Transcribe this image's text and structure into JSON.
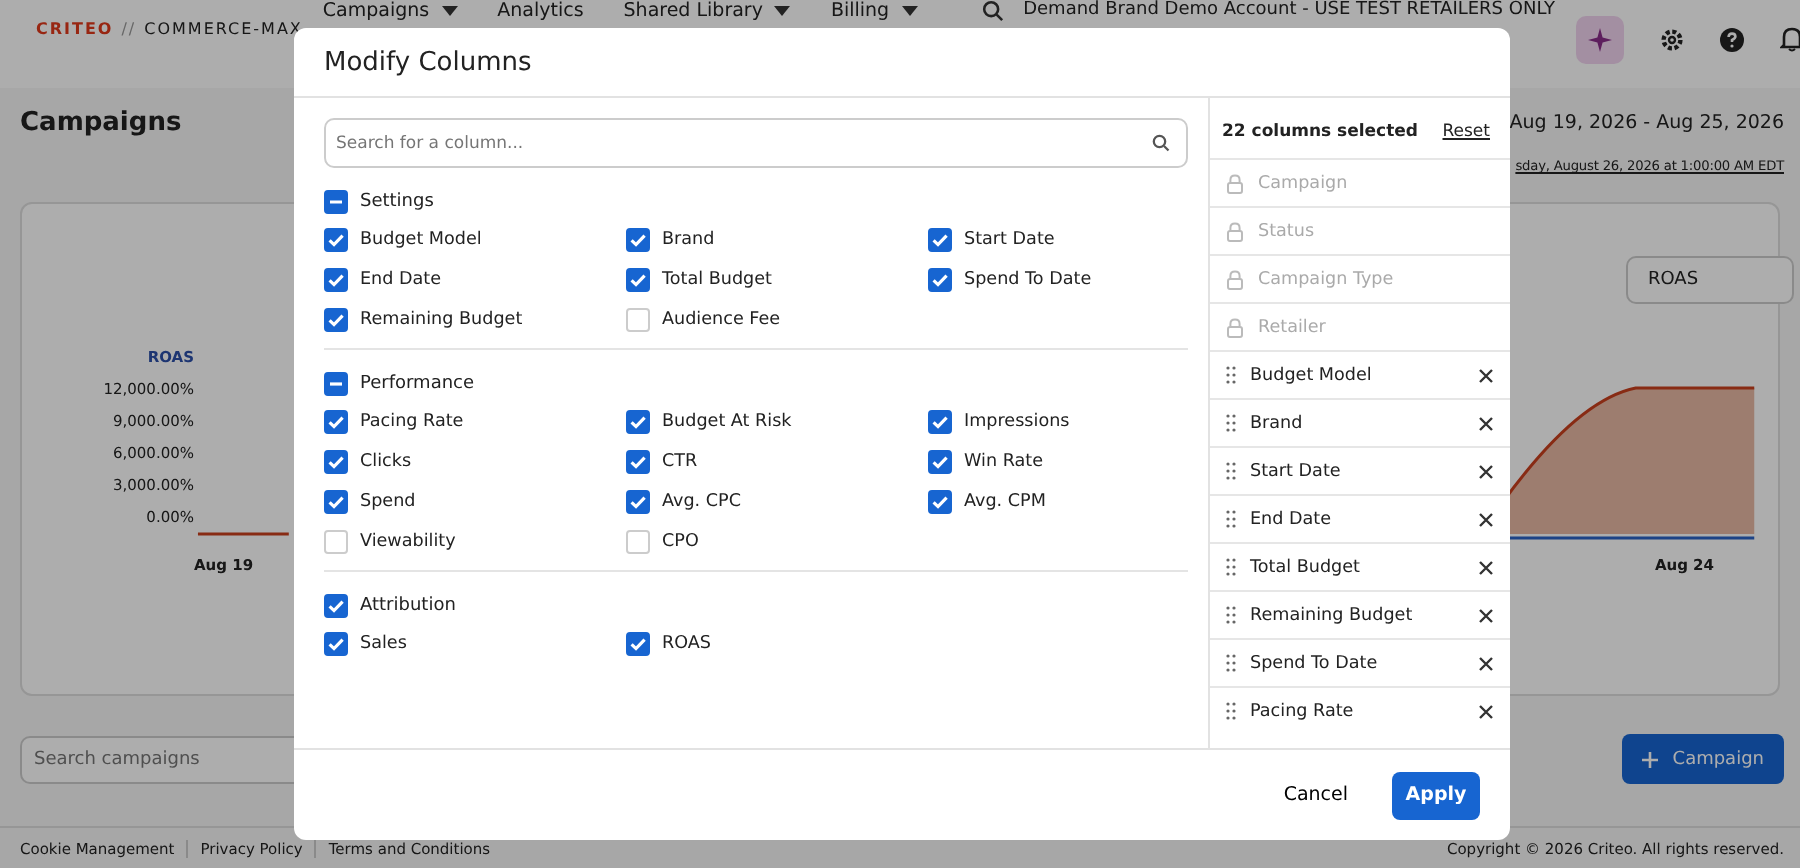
{
  "nav": {
    "logo": {
      "brand": "CRITEO",
      "separator": "//",
      "product": "COMMERCE-MAX"
    },
    "items": [
      {
        "label": "Campaigns",
        "dropdown": true
      },
      {
        "label": "Analytics",
        "dropdown": false
      },
      {
        "label": "Shared Library",
        "dropdown": true
      },
      {
        "label": "Billing",
        "dropdown": true
      }
    ],
    "account": "Demand Brand Demo Account - USE TEST RETAILERS ONLY"
  },
  "page": {
    "title": "Campaigns",
    "date_range": "Aug 19, 2026 - Aug 25, 2026",
    "updated": "sday, August 26, 2026 at 1:00:00 AM EDT",
    "chart": {
      "metric_select": "ROAS",
      "axis_title": "ROAS",
      "yticks": [
        "12,000.00%",
        "9,000.00%",
        "6,000.00%",
        "3,000.00%",
        "0.00%"
      ],
      "xlabels": [
        "Aug 19",
        "Aug 24"
      ]
    },
    "search": {
      "placeholder": "Search campaigns"
    },
    "new_button": "Campaign"
  },
  "footer": {
    "links": [
      "Cookie Management",
      "Privacy Policy",
      "Terms and Conditions"
    ],
    "copyright": "Copyright © 2026 Criteo. All rights reserved."
  },
  "modal": {
    "title": "Modify Columns",
    "search": {
      "placeholder": "Search for a column..."
    },
    "sections": [
      {
        "title": "Settings",
        "checked": true,
        "indeterminate": true,
        "options": [
          {
            "label": "Budget Model",
            "checked": true
          },
          {
            "label": "Brand",
            "checked": true
          },
          {
            "label": "Start Date",
            "checked": true
          },
          {
            "label": "End Date",
            "checked": true
          },
          {
            "label": "Total Budget",
            "checked": true
          },
          {
            "label": "Spend To Date",
            "checked": true
          },
          {
            "label": "Remaining Budget",
            "checked": true
          },
          {
            "label": "Audience Fee",
            "checked": false
          }
        ]
      },
      {
        "title": "Performance",
        "checked": true,
        "indeterminate": true,
        "options": [
          {
            "label": "Pacing Rate",
            "checked": true
          },
          {
            "label": "Budget At Risk",
            "checked": true
          },
          {
            "label": "Impressions",
            "checked": true
          },
          {
            "label": "Clicks",
            "checked": true
          },
          {
            "label": "CTR",
            "checked": true
          },
          {
            "label": "Win Rate",
            "checked": true
          },
          {
            "label": "Spend",
            "checked": true
          },
          {
            "label": "Avg. CPC",
            "checked": true
          },
          {
            "label": "Avg. CPM",
            "checked": true
          },
          {
            "label": "Viewability",
            "checked": false
          },
          {
            "label": "CPO",
            "checked": false
          }
        ]
      },
      {
        "title": "Attribution",
        "checked": true,
        "indeterminate": false,
        "options": [
          {
            "label": "Sales",
            "checked": true
          },
          {
            "label": "ROAS",
            "checked": true
          }
        ]
      }
    ],
    "selected_count": "22 columns selected",
    "reset": "Reset",
    "selected_columns": [
      {
        "label": "Campaign",
        "kind": "locked"
      },
      {
        "label": "Status",
        "kind": "locked"
      },
      {
        "label": "Campaign Type",
        "kind": "locked"
      },
      {
        "label": "Retailer",
        "kind": "locked"
      },
      {
        "label": "Budget Model",
        "kind": "removable"
      },
      {
        "label": "Brand",
        "kind": "removable"
      },
      {
        "label": "Start Date",
        "kind": "removable"
      },
      {
        "label": "End Date",
        "kind": "removable"
      },
      {
        "label": "Total Budget",
        "kind": "removable"
      },
      {
        "label": "Remaining Budget",
        "kind": "removable"
      },
      {
        "label": "Spend To Date",
        "kind": "removable"
      },
      {
        "label": "Pacing Rate",
        "kind": "removable"
      }
    ],
    "buttons": {
      "cancel": "Cancel",
      "apply": "Apply"
    }
  }
}
